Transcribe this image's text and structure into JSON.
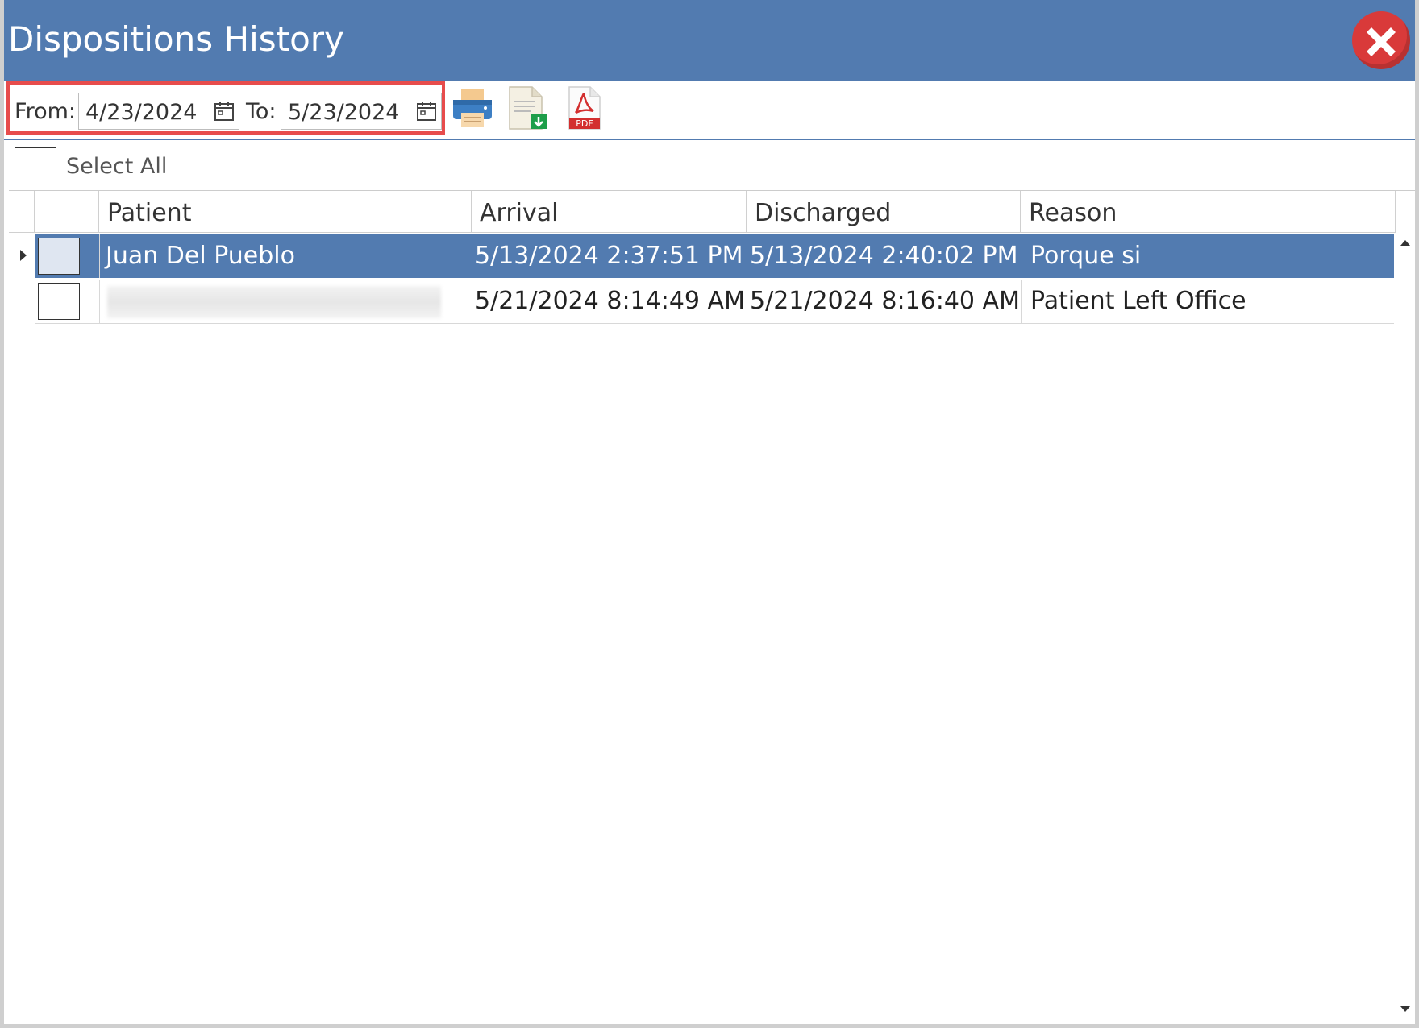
{
  "window": {
    "title": "Dispositions History",
    "close_label": "Close"
  },
  "toolbar": {
    "from_label": "From:",
    "from_value": "4/23/2024",
    "to_label": "To:",
    "to_value": "5/23/2024",
    "icons": [
      "printer-icon",
      "export-document-icon",
      "pdf-icon"
    ],
    "pdf_badge": "PDF"
  },
  "select_all": {
    "label": "Select All",
    "checked": false
  },
  "table": {
    "columns": [
      "Patient",
      "Arrival",
      "Discharged",
      "Reason"
    ],
    "rows": [
      {
        "patient": "Juan Del Pueblo",
        "arrival": "5/13/2024 2:37:51 PM",
        "discharged": "5/13/2024 2:40:02 PM",
        "reason": "Porque si",
        "selected": true
      },
      {
        "patient": "",
        "arrival": "5/21/2024 8:14:49 AM",
        "discharged": "5/21/2024 8:16:40 AM",
        "reason": "Patient Left Office",
        "selected": false
      }
    ]
  },
  "colors": {
    "accent": "#527bb0",
    "highlight": "#e74c4c",
    "close": "#d93a3a"
  }
}
